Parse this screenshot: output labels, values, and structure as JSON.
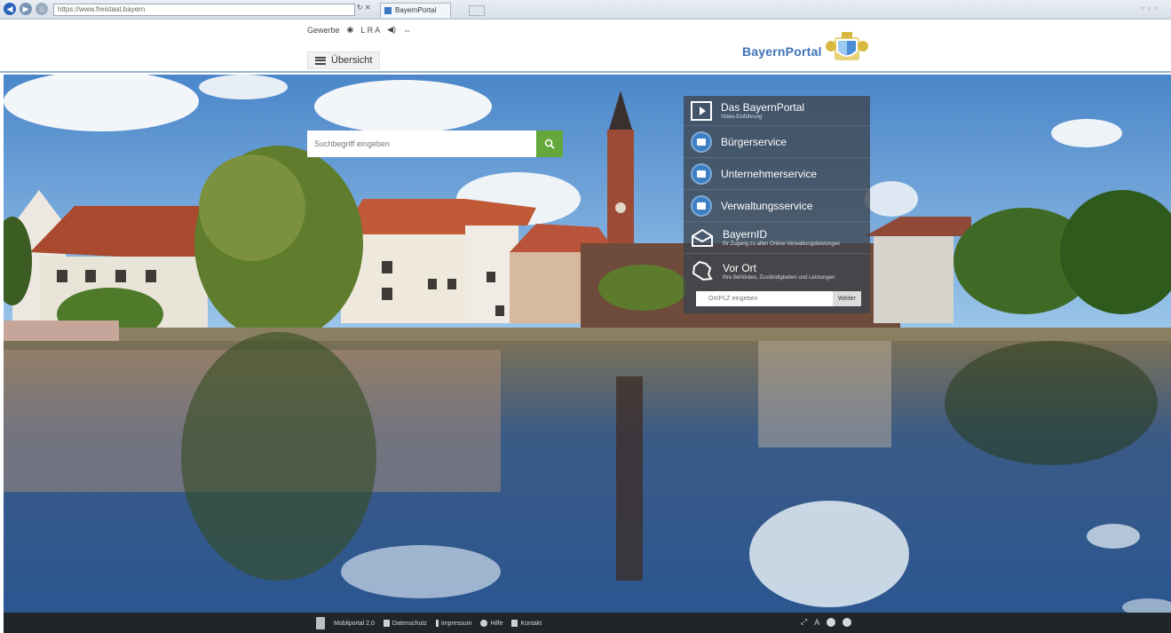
{
  "browser": {
    "url": "https://www.freistaat.bayern",
    "tab_title": "BayernPortal"
  },
  "header": {
    "utility": [
      "Gewerbe",
      "◉",
      "L R A",
      "◀)",
      "⇔"
    ],
    "overview_label": "Übersicht",
    "brand": "BayernPortal"
  },
  "search": {
    "placeholder": "Suchbegriff eingeben"
  },
  "side_menu": {
    "intro_title": "Das BayernPortal",
    "intro_sub": "Video-Einführung",
    "items": [
      {
        "label": "Bürgerservice",
        "icon": "people-icon"
      },
      {
        "label": "Unternehmerservice",
        "icon": "briefcase-icon"
      },
      {
        "label": "Verwaltungsservice",
        "icon": "building-icon"
      }
    ],
    "bayernid_title": "BayernID",
    "bayernid_sub": "Ihr Zugang zu allen Online-Verwaltungsleistungen",
    "vorort_title": "Vor Ort",
    "vorort_sub": "Ihre Behörden, Zuständigkeiten und Leistungen",
    "location_placeholder": "Ort/PLZ eingeben",
    "location_button": "Weiter"
  },
  "footer": {
    "app_label": "Mobilportal 2.0",
    "links": [
      "Datenschutz",
      "Impressum",
      "Hilfe",
      "Kontakt"
    ],
    "right": [
      "⤢",
      "A"
    ]
  },
  "colors": {
    "brand_blue": "#3d72b8",
    "search_green": "#64a83b",
    "menu_icon_blue": "#3d7ec4",
    "footer_bg": "#1f2529"
  }
}
